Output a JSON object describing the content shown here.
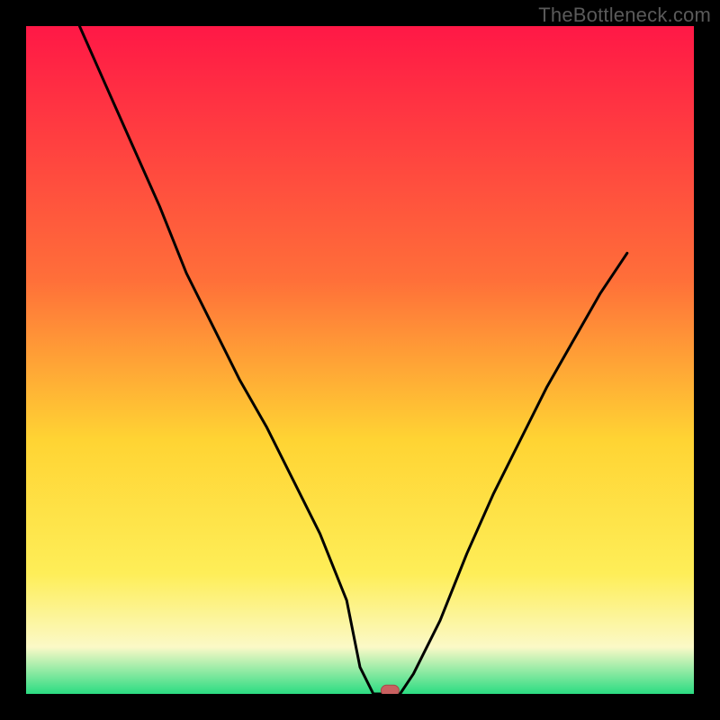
{
  "watermark": "TheBottleneck.com",
  "colors": {
    "frame": "#000000",
    "curve": "#000000",
    "marker_fill": "#c96060",
    "marker_stroke": "#a84848",
    "grad_top": "#ff1846",
    "grad_mid1": "#ff6f39",
    "grad_mid2": "#ffd433",
    "grad_mid3": "#feee58",
    "grad_mid4": "#fbf9c7",
    "grad_bottom": "#2bdc82"
  },
  "chart_data": {
    "type": "line",
    "title": "",
    "xlabel": "",
    "ylabel": "",
    "xlim": [
      0,
      100
    ],
    "ylim": [
      0,
      100
    ],
    "x": [
      8,
      12,
      16,
      20,
      24,
      28,
      32,
      36,
      40,
      44,
      48,
      50,
      52,
      54,
      56,
      58,
      62,
      66,
      70,
      74,
      78,
      82,
      86,
      90
    ],
    "values": [
      100,
      91,
      82,
      73,
      63,
      55,
      47,
      40,
      32,
      24,
      14,
      4,
      0,
      0,
      0,
      3,
      11,
      21,
      30,
      38,
      46,
      53,
      60,
      66
    ],
    "marker": {
      "x": 54.5,
      "y": 0.5
    }
  }
}
